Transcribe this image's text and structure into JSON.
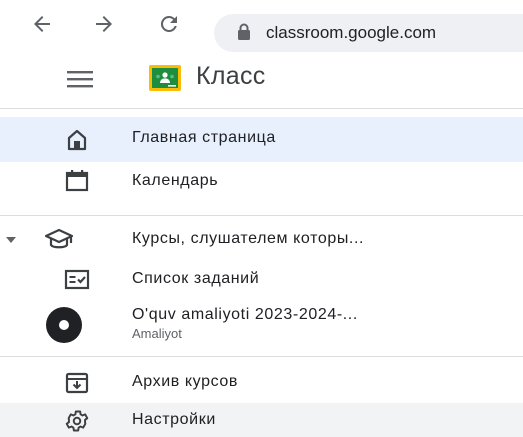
{
  "browser": {
    "url": "classroom.google.com"
  },
  "app": {
    "title": "Класс"
  },
  "sidebar": {
    "items": [
      {
        "label": "Главная страница"
      },
      {
        "label": "Календарь"
      },
      {
        "label": "Курсы, слушателем которы..."
      },
      {
        "label": "Список заданий"
      },
      {
        "label": "O'quv amaliyoti 2023-2024-...",
        "sub": "Amaliyot"
      },
      {
        "label": "Архив курсов"
      },
      {
        "label": "Настройки"
      }
    ]
  },
  "colors": {
    "active_bg": "#e8f0fe",
    "logo_green": "#1e8e3e",
    "logo_yellow": "#fbbc04",
    "text": "#202124"
  }
}
